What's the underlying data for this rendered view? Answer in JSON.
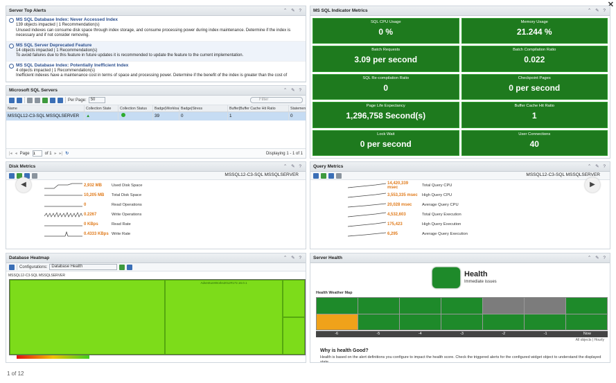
{
  "alerts_panel": {
    "title": "Server Top Alerts",
    "items": [
      {
        "title": "MS SQL Database Index: Never Accessed Index",
        "line1": "139 objects impacted | 1 Recommendation(s)",
        "line2": "Unused indexes can consume disk space through index storage, and consume processing power during index maintenance. Determine if the index is",
        "line3": "necessary and if not consider removing."
      },
      {
        "title": "MS SQL Server Deprecated Feature",
        "line1": "14 objects impacted | 1 Recommendation(s)",
        "line2": "To avoid failures due to this feature in future updates it is recommended to update the feature to the current implementation.",
        "line3": ""
      },
      {
        "title": "MS SQL Database Index: Potentially Inefficient Index",
        "line1": "4 objects impacted | 1 Recommendation(s)",
        "line2": "Inefficient indexes have a maintenance cost in terms of space and processing power. Determine if the benefit of the index is greater than the cost of",
        "line3": ""
      }
    ]
  },
  "servers_panel": {
    "title": "Microsoft SQL Servers",
    "per_page_label": "Per Page:",
    "per_page_value": "50",
    "filter_placeholder": "Filter",
    "columns": [
      "Name",
      "Collection State",
      "Collection Status",
      "Badge|Workload",
      "Badge|Stress",
      "Buffer|Buffer Cache Hit Ratio",
      "Statemen"
    ],
    "row": {
      "name": "MSSQL12-C3-SQL MSSQLSERVER",
      "workload": "39",
      "stress": "0",
      "buffer": "1",
      "statements": "0"
    },
    "pager": {
      "page_label": "Page",
      "page_value": "1",
      "of_label": "of 1",
      "displaying": "Displaying 1 - 1 of 1"
    }
  },
  "indicator_panel": {
    "title": "MS SQL Indicator Metrics",
    "tiles": [
      {
        "label": "SQL CPU Usage",
        "value": "0 %"
      },
      {
        "label": "Memory Usage",
        "value": "21.244 %"
      },
      {
        "label": "Batch Requests",
        "value": "3.09 per second"
      },
      {
        "label": "Batch Compilation Ratio",
        "value": "0.022"
      },
      {
        "label": "SQL Re-compilation Ratio",
        "value": "0"
      },
      {
        "label": "Checkpoint Pages",
        "value": "0 per second"
      },
      {
        "label": "Page Life Expectancy",
        "value": "1,296,758 Second(s)"
      },
      {
        "label": "Buffer Cache Hit Ratio",
        "value": "1"
      },
      {
        "label": "Lock Wait",
        "value": "0 per second"
      },
      {
        "label": "User Connections",
        "value": "40"
      }
    ]
  },
  "disk_panel": {
    "title": "Disk Metrics",
    "server": "MSSQL12-C3-SQL MSSQLSERVER",
    "metrics": [
      {
        "value": "2,932 MB",
        "label": "Used Disk Space"
      },
      {
        "value": "10,205 MB",
        "label": "Total Disk Space"
      },
      {
        "value": "0",
        "label": "Read Operations"
      },
      {
        "value": "0.2267",
        "label": "Write Operations"
      },
      {
        "value": "0 KBps",
        "label": "Read Rate"
      },
      {
        "value": "0.4333 KBps",
        "label": "Write Rate"
      }
    ]
  },
  "query_panel": {
    "title": "Query Metrics",
    "server": "MSSQL12-C3-SQL MSSQLSERVER",
    "metrics": [
      {
        "value": "14,420,339 msec",
        "label": "Total Query CPU"
      },
      {
        "value": "3,553,335 msec",
        "label": "High Query CPU"
      },
      {
        "value": "20,028 msec",
        "label": "Average Query CPU"
      },
      {
        "value": "4,532,603",
        "label": "Total Query Execution"
      },
      {
        "value": "175,423",
        "label": "High Query Execution"
      },
      {
        "value": "6,295",
        "label": "Average Query Execution"
      }
    ]
  },
  "heatmap_panel": {
    "title": "Database Heatmap",
    "config_label": "Configurations:",
    "config_value": "Database Health",
    "root_label": "MSSQL12-C3-SQL MSSQLSERVER",
    "cell_label": "AdventureWorks2012#172.16.0.1"
  },
  "health_panel": {
    "title": "Server Health",
    "heading": "Health",
    "subheading": "Immediate issues",
    "weather_title": "Health Weather Map",
    "axis": [
      "-6",
      "-5",
      "-4",
      "-3",
      "-2",
      "-1",
      "Now"
    ],
    "note": "All objects | Hourly",
    "question": "Why is health Good?",
    "description": "Health is based on the alert definitions you configure to impact the health score. Check the triggered alerts for the configured widget object to understand the displayed state."
  },
  "footer": {
    "page_count": "1 of 12"
  },
  "colors": {
    "tile_green": "#1e7a1e",
    "accent_orange": "#e07a1a",
    "heat_green": "#7ddc1a"
  }
}
